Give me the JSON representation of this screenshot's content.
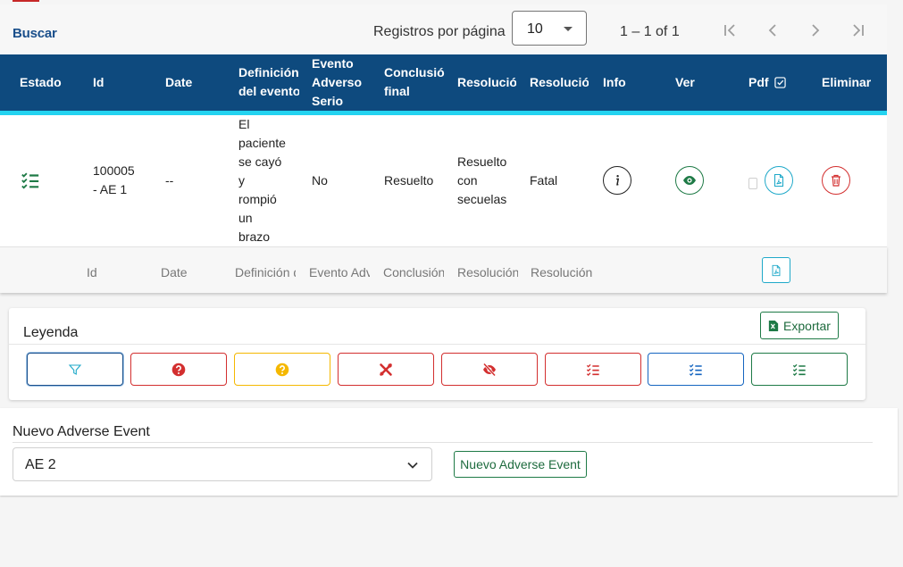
{
  "toolbar": {
    "search_label": "Buscar",
    "rows_per_page_label": "Registros por página",
    "rows_per_page_value": "10",
    "range_label": "1 – 1 of 1"
  },
  "table": {
    "headers": {
      "estado": "Estado",
      "id": "Id",
      "date": "Date",
      "definicion_1": "Definición",
      "definicion_2": "del evento",
      "evento_1": "Evento",
      "evento_2": "Adverso",
      "evento_3": "Serio",
      "conclusion_1": "Conclusión",
      "conclusion_2": "final",
      "resolucion1": "Resolución",
      "resolucion2": "Resolución",
      "info": "Info",
      "ver": "Ver",
      "pdf": "Pdf",
      "eliminar": "Eliminar"
    },
    "row": {
      "id_1": "100005",
      "id_2": "- AE 1",
      "date": "--",
      "definicion": [
        "El",
        "paciente",
        "se cayó",
        "y",
        "rompió",
        "un",
        "brazo"
      ],
      "evento_adverso_serio": "No",
      "conclusion_final": "Resuelto",
      "resolucion1": [
        "Resuelto",
        "con",
        "secuelas"
      ],
      "resolucion2": "Fatal"
    },
    "filters": {
      "id": "Id",
      "date": "Date",
      "definicion": "Definición del evento",
      "evento": "Evento Adverso Serio",
      "conclusion": "Conclusión final",
      "resolucion1": "Resolución",
      "resolucion2": "Resolución"
    }
  },
  "legend": {
    "title": "Leyenda",
    "export_label": "Exportar"
  },
  "nuevo": {
    "title": "Nuevo Adverse Event",
    "select_value": "AE 2",
    "button_label": "Nuevo Adverse Event"
  },
  "colors": {
    "header_bg": "#0e4a7e",
    "accent_line": "#23d3f0",
    "link_blue": "#1a4f8b",
    "green": "#1e7a46",
    "red": "#d32f2f",
    "yellow": "#f5b800",
    "blue": "#1565c0",
    "teal": "#1fa9c9"
  }
}
